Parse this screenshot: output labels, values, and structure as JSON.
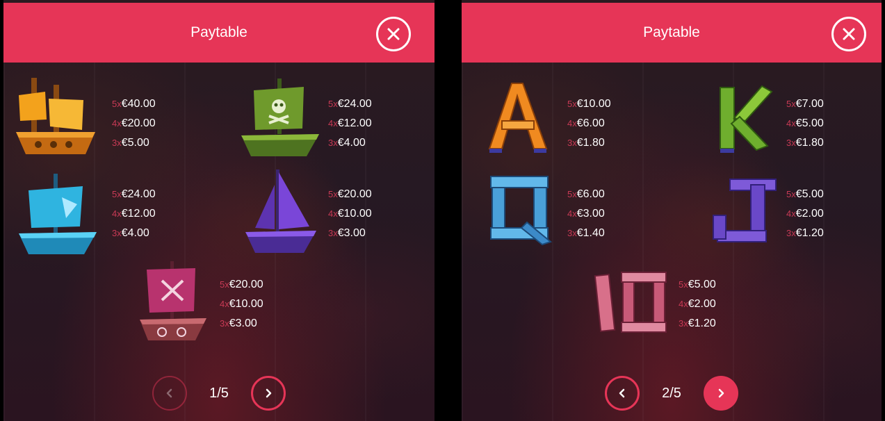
{
  "left_panel": {
    "title": "Paytable",
    "page_indicator": "1/5",
    "symbols": [
      {
        "icon": "golden-ship-icon",
        "payouts": [
          {
            "mult": "5x",
            "amount": "€40.00"
          },
          {
            "mult": "4x",
            "amount": "€20.00"
          },
          {
            "mult": "3x",
            "amount": "€5.00"
          }
        ]
      },
      {
        "icon": "green-pirate-ship-icon",
        "payouts": [
          {
            "mult": "5x",
            "amount": "€24.00"
          },
          {
            "mult": "4x",
            "amount": "€12.00"
          },
          {
            "mult": "3x",
            "amount": "€4.00"
          }
        ]
      },
      {
        "icon": "blue-ship-icon",
        "payouts": [
          {
            "mult": "5x",
            "amount": "€24.00"
          },
          {
            "mult": "4x",
            "amount": "€12.00"
          },
          {
            "mult": "3x",
            "amount": "€4.00"
          }
        ]
      },
      {
        "icon": "purple-sailboat-icon",
        "payouts": [
          {
            "mult": "5x",
            "amount": "€20.00"
          },
          {
            "mult": "4x",
            "amount": "€10.00"
          },
          {
            "mult": "3x",
            "amount": "€3.00"
          }
        ]
      },
      {
        "icon": "pink-raft-icon",
        "payouts": [
          {
            "mult": "5x",
            "amount": "€20.00"
          },
          {
            "mult": "4x",
            "amount": "€10.00"
          },
          {
            "mult": "3x",
            "amount": "€3.00"
          }
        ]
      }
    ]
  },
  "right_panel": {
    "title": "Paytable",
    "page_indicator": "2/5",
    "symbols": [
      {
        "icon": "letter-a-icon",
        "glyph": "A",
        "payouts": [
          {
            "mult": "5x",
            "amount": "€10.00"
          },
          {
            "mult": "4x",
            "amount": "€6.00"
          },
          {
            "mult": "3x",
            "amount": "€1.80"
          }
        ]
      },
      {
        "icon": "letter-k-icon",
        "glyph": "K",
        "payouts": [
          {
            "mult": "5x",
            "amount": "€7.00"
          },
          {
            "mult": "4x",
            "amount": "€5.00"
          },
          {
            "mult": "3x",
            "amount": "€1.80"
          }
        ]
      },
      {
        "icon": "letter-q-icon",
        "glyph": "Q",
        "payouts": [
          {
            "mult": "5x",
            "amount": "€6.00"
          },
          {
            "mult": "4x",
            "amount": "€3.00"
          },
          {
            "mult": "3x",
            "amount": "€1.40"
          }
        ]
      },
      {
        "icon": "letter-j-icon",
        "glyph": "J",
        "payouts": [
          {
            "mult": "5x",
            "amount": "€5.00"
          },
          {
            "mult": "4x",
            "amount": "€2.00"
          },
          {
            "mult": "3x",
            "amount": "€1.20"
          }
        ]
      },
      {
        "icon": "number-10-icon",
        "glyph": "10",
        "payouts": [
          {
            "mult": "5x",
            "amount": "€5.00"
          },
          {
            "mult": "4x",
            "amount": "€2.00"
          },
          {
            "mult": "3x",
            "amount": "€1.20"
          }
        ]
      }
    ]
  },
  "colors": {
    "accent": "#e63557",
    "multiplier": "#c83a55",
    "background": "#261923"
  }
}
